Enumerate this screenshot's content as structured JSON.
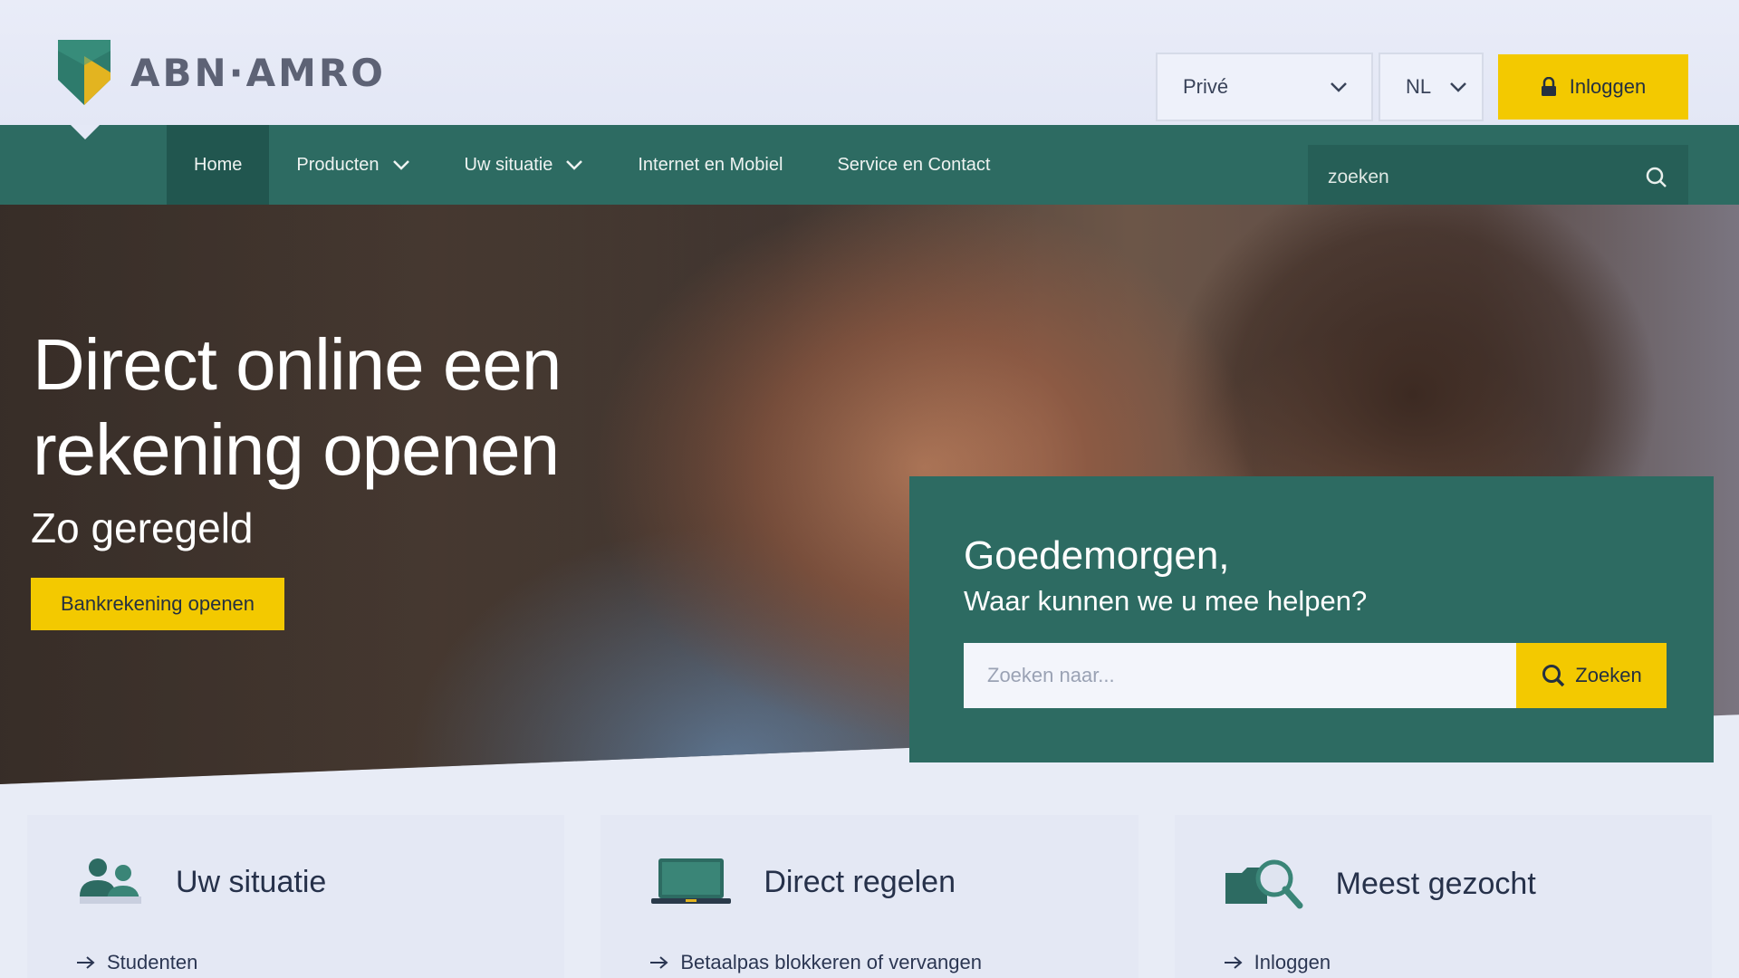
{
  "brand": {
    "name": "ABN·AMRO",
    "accent": "#2d6b62",
    "highlight": "#f3c900"
  },
  "header": {
    "segment_select": "Privé",
    "language_select": "NL",
    "login_label": "Inloggen"
  },
  "nav": {
    "items": [
      {
        "label": "Home",
        "active": true,
        "has_dropdown": false
      },
      {
        "label": "Producten",
        "active": false,
        "has_dropdown": true
      },
      {
        "label": "Uw situatie",
        "active": false,
        "has_dropdown": true
      },
      {
        "label": "Internet en Mobiel",
        "active": false,
        "has_dropdown": false
      },
      {
        "label": "Service en Contact",
        "active": false,
        "has_dropdown": false
      }
    ],
    "search_placeholder": "zoeken",
    "search_icon": "search-icon"
  },
  "hero": {
    "title": "Direct online een rekening openen",
    "subtitle": "Zo geregeld",
    "cta_label": "Bankrekening openen"
  },
  "help": {
    "greeting": "Goedemorgen,",
    "question": "Waar kunnen we u mee helpen?",
    "search_placeholder": "Zoeken naar...",
    "search_button": "Zoeken"
  },
  "cards": [
    {
      "icon": "people-icon",
      "title": "Uw situatie",
      "link": "Studenten"
    },
    {
      "icon": "laptop-icon",
      "title": "Direct regelen",
      "link": "Betaalpas blokkeren of vervangen"
    },
    {
      "icon": "magnifier-folder-icon",
      "title": "Meest gezocht",
      "link": "Inloggen"
    }
  ]
}
